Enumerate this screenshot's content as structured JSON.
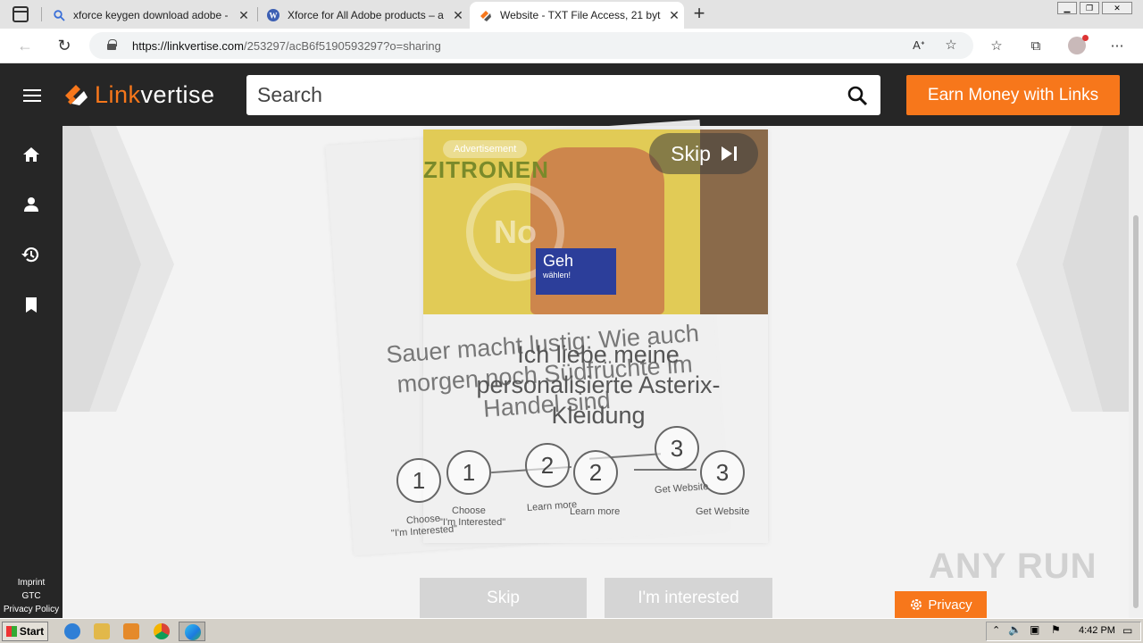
{
  "browser": {
    "tabs": [
      {
        "title": "xforce keygen download adobe -",
        "favicon": "search-icon"
      },
      {
        "title": "Xforce for All Adobe products – a",
        "favicon": "wordpress-icon"
      },
      {
        "title": "Website - TXT File Access, 21 byt",
        "favicon": "linkvertise-icon"
      }
    ],
    "url_host": "https://linkvertise.com",
    "url_path": "/253297/acB6f5190593297?o=sharing"
  },
  "site": {
    "logo_accent": "Link",
    "logo_rest": "vertise",
    "search_placeholder": "Search",
    "earn_button": "Earn Money with Links",
    "accent_color": "#f7771b"
  },
  "sidebar": {
    "footer_links": [
      "Imprint",
      "GTC",
      "Privacy Policy"
    ]
  },
  "ad": {
    "badge": "Advertisement",
    "title": "ZITRONEN",
    "no_text": "No",
    "geh_text": "Geh",
    "geh_sub": "wählen!",
    "skip_label": "Skip",
    "headline_front": "Ich liebe meine personalisierte Asterix-Kleidung",
    "headline_back": "Sauer macht lustig: Wie auch morgen noch Südfrüchte im Handel sind"
  },
  "steps": [
    {
      "number": "1",
      "label": "Choose",
      "sublabel": "\"I'm Interested\""
    },
    {
      "number": "2",
      "label": "Learn more"
    },
    {
      "number": "3",
      "label": "Get Website"
    }
  ],
  "actions": {
    "skip": "Skip",
    "interested": "I'm interested",
    "privacy": "Privacy"
  },
  "watermark": "ANY RUN",
  "taskbar": {
    "start": "Start",
    "clock": "4:42 PM"
  }
}
